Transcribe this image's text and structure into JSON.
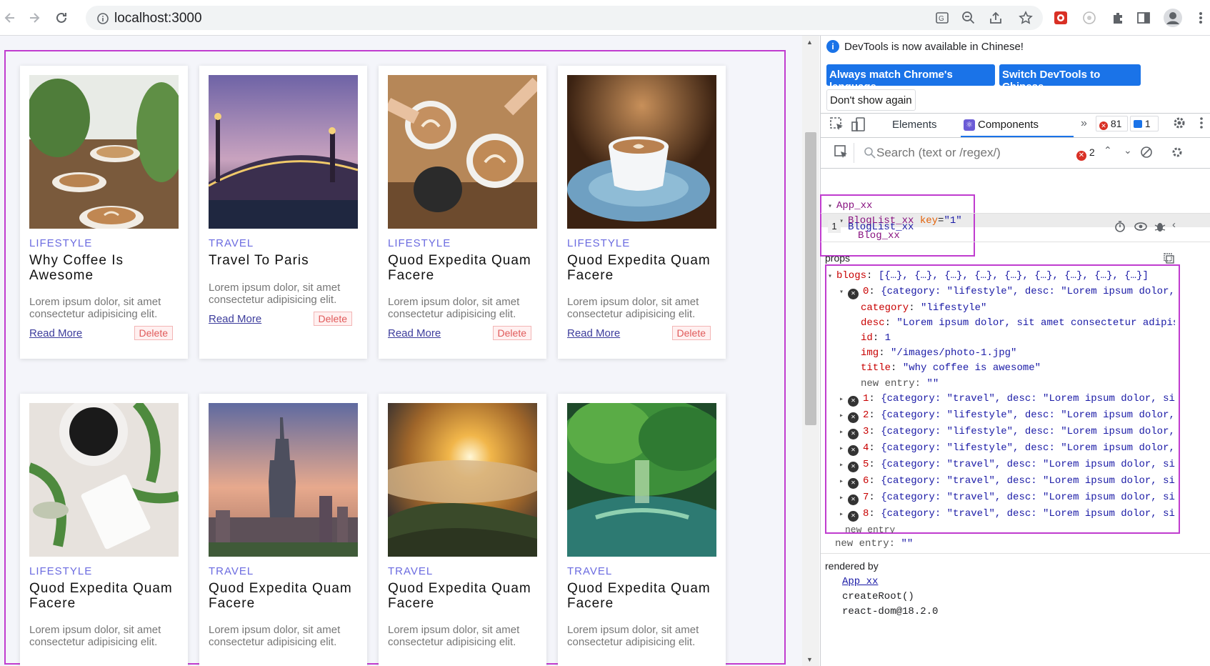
{
  "browser": {
    "url": "localhost:3000"
  },
  "blog": {
    "cards": [
      {
        "category": "LIFESTYLE",
        "title": "Why Coffee Is Awesome",
        "desc": "Lorem ipsum dolor, sit amet consectetur adipisicing elit.",
        "read": "Read More",
        "delete": "Delete",
        "image": "coffee-cups"
      },
      {
        "category": "TRAVEL",
        "title": "Travel To Paris",
        "desc": "Lorem ipsum dolor, sit amet consectetur adipisicing elit.",
        "read": "Read More",
        "delete": "Delete",
        "image": "paris-bridge"
      },
      {
        "category": "LIFESTYLE",
        "title": "Quod Expedita Quam Facere",
        "desc": "Lorem ipsum dolor, sit amet consectetur adipisicing elit.",
        "read": "Read More",
        "delete": "Delete",
        "image": "coffee-toast"
      },
      {
        "category": "LIFESTYLE",
        "title": "Quod Expedita Quam Facere",
        "desc": "Lorem ipsum dolor, sit amet consectetur adipisicing elit.",
        "read": "Read More",
        "delete": "Delete",
        "image": "coffee-saucer"
      },
      {
        "category": "LIFESTYLE",
        "title": "Quod Expedita Quam Facere",
        "desc": "Lorem ipsum dolor, sit amet consectetur adipisicing elit.",
        "image": "coffee-leaves"
      },
      {
        "category": "TRAVEL",
        "title": "Quod Expedita Quam Facere",
        "desc": "Lorem ipsum dolor, sit amet consectetur adipisicing elit.",
        "image": "taipei-skyline"
      },
      {
        "category": "TRAVEL",
        "title": "Quod Expedita Quam Facere",
        "desc": "Lorem ipsum dolor, sit amet consectetur adipisicing elit.",
        "image": "sunrise-clouds"
      },
      {
        "category": "TRAVEL",
        "title": "Quod Expedita Quam Facere",
        "desc": "Lorem ipsum dolor, sit amet consectetur adipisicing elit.",
        "image": "green-river"
      }
    ]
  },
  "devtools": {
    "notice": "DevTools is now available in Chinese!",
    "btn_match": "Always match Chrome's language",
    "btn_switch": "Switch DevTools to Chinese",
    "btn_dont_show": "Don't show again",
    "tab_elements": "Elements",
    "tab_components": "Components",
    "error_count": "81",
    "message_count": "1",
    "search_placeholder": "Search (text or /regex/)",
    "search_errors": "2",
    "tree": {
      "app": "App_xx",
      "bloglist": "BlogList_xx",
      "key_attr": "key",
      "key_value": "\"1\"",
      "blog": "Blog_xx"
    },
    "selected_index": "1",
    "selected_name": "BlogList_xx",
    "props_label": "props",
    "blogs_key": "blogs",
    "blogs_summary": "[{…}, {…}, {…}, {…}, {…}, {…}, {…}, {…}, {…}]",
    "item0": {
      "index": "0",
      "summary": "{category: \"lifestyle\", desc: \"Lorem ipsum dolor, s…}",
      "category": "\"lifestyle\"",
      "desc": "\"Lorem ipsum dolor, sit amet consectetur adipisicing",
      "id": "1",
      "img": "\"/images/photo-1.jpg\"",
      "title": "\"why coffee is awesome\"",
      "new_entry": "\"\""
    },
    "items": [
      {
        "index": "1",
        "summary": "{category: \"travel\", desc: \"Lorem ipsum dolor, sit …}"
      },
      {
        "index": "2",
        "summary": "{category: \"lifestyle\", desc: \"Lorem ipsum dolor, s…}"
      },
      {
        "index": "3",
        "summary": "{category: \"lifestyle\", desc: \"Lorem ipsum dolor, s…}"
      },
      {
        "index": "4",
        "summary": "{category: \"lifestyle\", desc: \"Lorem ipsum dolor, s…}"
      },
      {
        "index": "5",
        "summary": "{category: \"travel\", desc: \"Lorem ipsum dolor, sit …}"
      },
      {
        "index": "6",
        "summary": "{category: \"travel\", desc: \"Lorem ipsum dolor, sit …}"
      },
      {
        "index": "7",
        "summary": "{category: \"travel\", desc: \"Lorem ipsum dolor, sit …}"
      },
      {
        "index": "8",
        "summary": "{category: \"travel\", desc: \"Lorem ipsum dolor, sit …}"
      }
    ],
    "new_entry_label": "new entry",
    "new_entry_value": "\"\"",
    "rendered_by_label": "rendered by",
    "rendered_by": [
      "App_xx",
      "createRoot()",
      "react-dom@18.2.0"
    ],
    "highlight_color": "#c03ccf"
  }
}
